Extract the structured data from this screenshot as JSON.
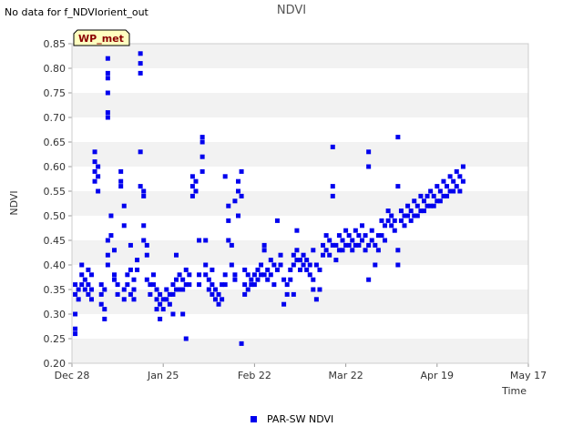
{
  "notice": "No data for f_NDVIorient_out",
  "badge": "WP_met",
  "chart_data": {
    "type": "scatter",
    "title": "NDVI",
    "xlabel": "Time",
    "ylabel": "NDVI",
    "ylim": [
      0.2,
      0.85
    ],
    "xlim": [
      0,
      140
    ],
    "x_ticks": [
      {
        "label": "Dec 28",
        "day": 0
      },
      {
        "label": "Jan 25",
        "day": 28
      },
      {
        "label": "Feb 22",
        "day": 56
      },
      {
        "label": "Mar 22",
        "day": 84
      },
      {
        "label": "Apr 19",
        "day": 112
      },
      {
        "label": "May 17",
        "day": 140
      }
    ],
    "y_ticks": [
      "0.20",
      "0.25",
      "0.30",
      "0.35",
      "0.40",
      "0.45",
      "0.50",
      "0.55",
      "0.60",
      "0.65",
      "0.70",
      "0.75",
      "0.80",
      "0.85"
    ],
    "grid": "horizontal bands",
    "legend_position": "bottom",
    "series": [
      {
        "name": "PAR-SW NDVI",
        "color": "#0000ee",
        "marker": "square",
        "points": [
          [
            1,
            0.36
          ],
          [
            1,
            0.34
          ],
          [
            1,
            0.3
          ],
          [
            1,
            0.27
          ],
          [
            1,
            0.26
          ],
          [
            2,
            0.35
          ],
          [
            2,
            0.33
          ],
          [
            3,
            0.4
          ],
          [
            3,
            0.38
          ],
          [
            3,
            0.36
          ],
          [
            4,
            0.37
          ],
          [
            4,
            0.35
          ],
          [
            5,
            0.39
          ],
          [
            5,
            0.36
          ],
          [
            5,
            0.34
          ],
          [
            6,
            0.38
          ],
          [
            6,
            0.35
          ],
          [
            6,
            0.33
          ],
          [
            7,
            0.63
          ],
          [
            7,
            0.61
          ],
          [
            7,
            0.59
          ],
          [
            7,
            0.57
          ],
          [
            8,
            0.6
          ],
          [
            8,
            0.58
          ],
          [
            8,
            0.55
          ],
          [
            9,
            0.36
          ],
          [
            9,
            0.34
          ],
          [
            9,
            0.32
          ],
          [
            10,
            0.35
          ],
          [
            10,
            0.31
          ],
          [
            10,
            0.29
          ],
          [
            11,
            0.45
          ],
          [
            11,
            0.42
          ],
          [
            11,
            0.4
          ],
          [
            11,
            0.82
          ],
          [
            11,
            0.79
          ],
          [
            11,
            0.78
          ],
          [
            11,
            0.75
          ],
          [
            11,
            0.71
          ],
          [
            11,
            0.7
          ],
          [
            12,
            0.5
          ],
          [
            12,
            0.46
          ],
          [
            13,
            0.43
          ],
          [
            13,
            0.38
          ],
          [
            13,
            0.37
          ],
          [
            14,
            0.36
          ],
          [
            14,
            0.34
          ],
          [
            15,
            0.59
          ],
          [
            15,
            0.57
          ],
          [
            15,
            0.56
          ],
          [
            16,
            0.52
          ],
          [
            16,
            0.48
          ],
          [
            16,
            0.35
          ],
          [
            16,
            0.33
          ],
          [
            17,
            0.38
          ],
          [
            17,
            0.36
          ],
          [
            18,
            0.44
          ],
          [
            18,
            0.39
          ],
          [
            18,
            0.34
          ],
          [
            19,
            0.37
          ],
          [
            19,
            0.35
          ],
          [
            19,
            0.33
          ],
          [
            20,
            0.41
          ],
          [
            20,
            0.39
          ],
          [
            21,
            0.83
          ],
          [
            21,
            0.81
          ],
          [
            21,
            0.79
          ],
          [
            21,
            0.63
          ],
          [
            21,
            0.56
          ],
          [
            22,
            0.55
          ],
          [
            22,
            0.54
          ],
          [
            22,
            0.48
          ],
          [
            22,
            0.45
          ],
          [
            23,
            0.44
          ],
          [
            23,
            0.42
          ],
          [
            23,
            0.37
          ],
          [
            24,
            0.36
          ],
          [
            24,
            0.34
          ],
          [
            25,
            0.38
          ],
          [
            25,
            0.36
          ],
          [
            26,
            0.35
          ],
          [
            26,
            0.33
          ],
          [
            26,
            0.31
          ],
          [
            27,
            0.34
          ],
          [
            27,
            0.32
          ],
          [
            27,
            0.29
          ],
          [
            28,
            0.33
          ],
          [
            28,
            0.31
          ],
          [
            29,
            0.35
          ],
          [
            29,
            0.33
          ],
          [
            30,
            0.34
          ],
          [
            30,
            0.32
          ],
          [
            31,
            0.36
          ],
          [
            31,
            0.34
          ],
          [
            31,
            0.3
          ],
          [
            32,
            0.42
          ],
          [
            32,
            0.37
          ],
          [
            32,
            0.35
          ],
          [
            33,
            0.38
          ],
          [
            33,
            0.35
          ],
          [
            34,
            0.37
          ],
          [
            34,
            0.35
          ],
          [
            34,
            0.3
          ],
          [
            35,
            0.39
          ],
          [
            35,
            0.36
          ],
          [
            35,
            0.25
          ],
          [
            36,
            0.38
          ],
          [
            36,
            0.36
          ],
          [
            37,
            0.58
          ],
          [
            37,
            0.56
          ],
          [
            37,
            0.54
          ],
          [
            38,
            0.57
          ],
          [
            38,
            0.55
          ],
          [
            39,
            0.45
          ],
          [
            39,
            0.38
          ],
          [
            39,
            0.36
          ],
          [
            40,
            0.66
          ],
          [
            40,
            0.65
          ],
          [
            40,
            0.62
          ],
          [
            40,
            0.59
          ],
          [
            41,
            0.45
          ],
          [
            41,
            0.4
          ],
          [
            41,
            0.38
          ],
          [
            42,
            0.37
          ],
          [
            42,
            0.35
          ],
          [
            43,
            0.39
          ],
          [
            43,
            0.36
          ],
          [
            43,
            0.34
          ],
          [
            44,
            0.35
          ],
          [
            44,
            0.33
          ],
          [
            45,
            0.34
          ],
          [
            45,
            0.32
          ],
          [
            46,
            0.36
          ],
          [
            46,
            0.33
          ],
          [
            47,
            0.38
          ],
          [
            47,
            0.36
          ],
          [
            47,
            0.58
          ],
          [
            48,
            0.52
          ],
          [
            48,
            0.49
          ],
          [
            48,
            0.45
          ],
          [
            49,
            0.44
          ],
          [
            49,
            0.4
          ],
          [
            50,
            0.38
          ],
          [
            50,
            0.37
          ],
          [
            50,
            0.53
          ],
          [
            51,
            0.55
          ],
          [
            51,
            0.57
          ],
          [
            51,
            0.5
          ],
          [
            52,
            0.59
          ],
          [
            52,
            0.54
          ],
          [
            52,
            0.24
          ],
          [
            53,
            0.39
          ],
          [
            53,
            0.36
          ],
          [
            53,
            0.34
          ],
          [
            54,
            0.38
          ],
          [
            54,
            0.35
          ],
          [
            55,
            0.37
          ],
          [
            55,
            0.36
          ],
          [
            56,
            0.38
          ],
          [
            56,
            0.36
          ],
          [
            57,
            0.39
          ],
          [
            57,
            0.37
          ],
          [
            58,
            0.4
          ],
          [
            58,
            0.38
          ],
          [
            59,
            0.44
          ],
          [
            59,
            0.43
          ],
          [
            59,
            0.38
          ],
          [
            60,
            0.39
          ],
          [
            60,
            0.37
          ],
          [
            61,
            0.41
          ],
          [
            61,
            0.38
          ],
          [
            62,
            0.4
          ],
          [
            62,
            0.36
          ],
          [
            63,
            0.49
          ],
          [
            63,
            0.39
          ],
          [
            64,
            0.42
          ],
          [
            64,
            0.4
          ],
          [
            65,
            0.37
          ],
          [
            65,
            0.32
          ],
          [
            66,
            0.36
          ],
          [
            66,
            0.34
          ],
          [
            67,
            0.39
          ],
          [
            67,
            0.37
          ],
          [
            68,
            0.42
          ],
          [
            68,
            0.4
          ],
          [
            68,
            0.34
          ],
          [
            69,
            0.47
          ],
          [
            69,
            0.43
          ],
          [
            69,
            0.41
          ],
          [
            70,
            0.41
          ],
          [
            70,
            0.39
          ],
          [
            71,
            0.42
          ],
          [
            71,
            0.4
          ],
          [
            72,
            0.41
          ],
          [
            72,
            0.39
          ],
          [
            73,
            0.4
          ],
          [
            73,
            0.38
          ],
          [
            74,
            0.43
          ],
          [
            74,
            0.37
          ],
          [
            74,
            0.35
          ],
          [
            75,
            0.4
          ],
          [
            75,
            0.33
          ],
          [
            76,
            0.39
          ],
          [
            76,
            0.35
          ],
          [
            77,
            0.44
          ],
          [
            77,
            0.42
          ],
          [
            78,
            0.46
          ],
          [
            78,
            0.43
          ],
          [
            79,
            0.45
          ],
          [
            79,
            0.42
          ],
          [
            80,
            0.64
          ],
          [
            80,
            0.56
          ],
          [
            80,
            0.54
          ],
          [
            80,
            0.44
          ],
          [
            81,
            0.44
          ],
          [
            81,
            0.41
          ],
          [
            82,
            0.46
          ],
          [
            82,
            0.43
          ],
          [
            83,
            0.45
          ],
          [
            83,
            0.43
          ],
          [
            84,
            0.47
          ],
          [
            84,
            0.44
          ],
          [
            85,
            0.46
          ],
          [
            85,
            0.44
          ],
          [
            86,
            0.45
          ],
          [
            86,
            0.43
          ],
          [
            87,
            0.47
          ],
          [
            87,
            0.44
          ],
          [
            88,
            0.46
          ],
          [
            88,
            0.44
          ],
          [
            89,
            0.48
          ],
          [
            89,
            0.45
          ],
          [
            90,
            0.46
          ],
          [
            90,
            0.43
          ],
          [
            91,
            0.63
          ],
          [
            91,
            0.6
          ],
          [
            91,
            0.44
          ],
          [
            91,
            0.37
          ],
          [
            92,
            0.47
          ],
          [
            92,
            0.45
          ],
          [
            93,
            0.44
          ],
          [
            93,
            0.4
          ],
          [
            94,
            0.46
          ],
          [
            94,
            0.43
          ],
          [
            95,
            0.49
          ],
          [
            95,
            0.46
          ],
          [
            96,
            0.48
          ],
          [
            96,
            0.45
          ],
          [
            97,
            0.51
          ],
          [
            97,
            0.49
          ],
          [
            98,
            0.5
          ],
          [
            98,
            0.48
          ],
          [
            99,
            0.49
          ],
          [
            99,
            0.47
          ],
          [
            100,
            0.66
          ],
          [
            100,
            0.56
          ],
          [
            100,
            0.43
          ],
          [
            100,
            0.4
          ],
          [
            101,
            0.51
          ],
          [
            101,
            0.49
          ],
          [
            102,
            0.5
          ],
          [
            102,
            0.48
          ],
          [
            103,
            0.52
          ],
          [
            103,
            0.5
          ],
          [
            104,
            0.51
          ],
          [
            104,
            0.49
          ],
          [
            105,
            0.53
          ],
          [
            105,
            0.5
          ],
          [
            106,
            0.52
          ],
          [
            106,
            0.5
          ],
          [
            107,
            0.54
          ],
          [
            107,
            0.51
          ],
          [
            108,
            0.53
          ],
          [
            108,
            0.51
          ],
          [
            109,
            0.54
          ],
          [
            109,
            0.52
          ],
          [
            110,
            0.55
          ],
          [
            110,
            0.52
          ],
          [
            111,
            0.54
          ],
          [
            111,
            0.52
          ],
          [
            112,
            0.56
          ],
          [
            112,
            0.53
          ],
          [
            113,
            0.55
          ],
          [
            113,
            0.53
          ],
          [
            114,
            0.57
          ],
          [
            114,
            0.54
          ],
          [
            115,
            0.56
          ],
          [
            115,
            0.54
          ],
          [
            116,
            0.58
          ],
          [
            116,
            0.55
          ],
          [
            117,
            0.57
          ],
          [
            117,
            0.55
          ],
          [
            118,
            0.59
          ],
          [
            118,
            0.56
          ],
          [
            119,
            0.58
          ],
          [
            119,
            0.55
          ],
          [
            120,
            0.6
          ],
          [
            120,
            0.57
          ]
        ]
      }
    ]
  }
}
